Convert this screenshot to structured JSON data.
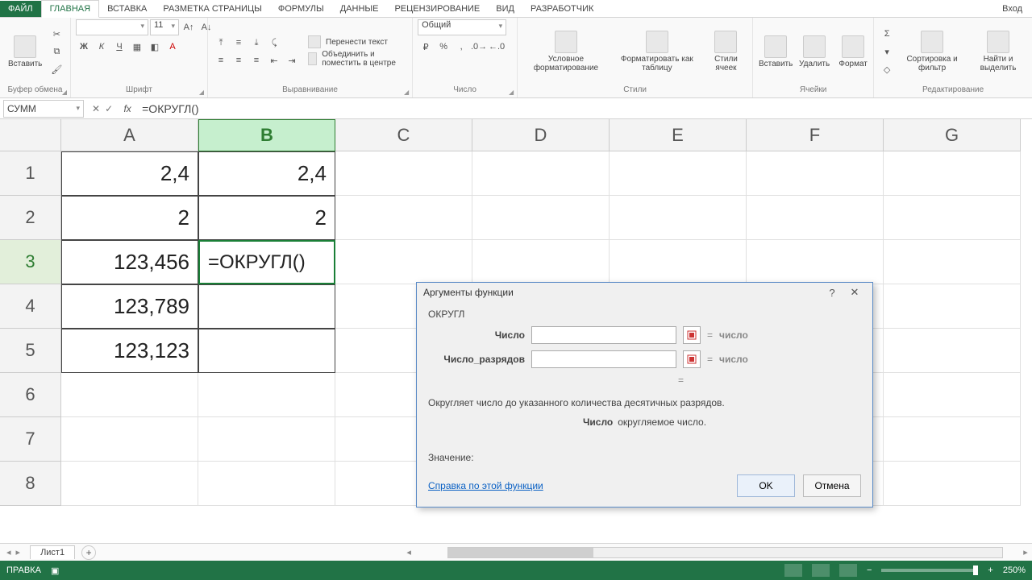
{
  "tabs": {
    "file": "ФАЙЛ",
    "items": [
      "ГЛАВНАЯ",
      "ВСТАВКА",
      "РАЗМЕТКА СТРАНИЦЫ",
      "ФОРМУЛЫ",
      "ДАННЫЕ",
      "РЕЦЕНЗИРОВАНИЕ",
      "ВИД",
      "РАЗРАБОТЧИК"
    ],
    "active_index": 0,
    "signin": "Вход"
  },
  "ribbon": {
    "clipboard": {
      "paste": "Вставить",
      "label": "Буфер обмена"
    },
    "font": {
      "size": "11",
      "bold": "Ж",
      "italic": "К",
      "underline": "Ч",
      "label": "Шрифт"
    },
    "alignment": {
      "wrap": "Перенести текст",
      "merge": "Объединить и поместить в центре",
      "label": "Выравнивание"
    },
    "number": {
      "format": "Общий",
      "percent": "%",
      "comma": "000",
      "label": "Число"
    },
    "styles": {
      "cond": "Условное форматирование",
      "table": "Форматировать как таблицу",
      "cell": "Стили ячеек",
      "label": "Стили"
    },
    "cells": {
      "insert": "Вставить",
      "delete": "Удалить",
      "format": "Формат",
      "label": "Ячейки"
    },
    "editing": {
      "sort": "Сортировка и фильтр",
      "find": "Найти и выделить",
      "label": "Редактирование"
    }
  },
  "formula_bar": {
    "name_box": "СУММ",
    "formula": "=ОКРУГЛ()"
  },
  "columns": [
    "A",
    "B",
    "C",
    "D",
    "E",
    "F",
    "G"
  ],
  "active_col_index": 1,
  "rows": [
    "1",
    "2",
    "3",
    "4",
    "5",
    "6",
    "7",
    "8"
  ],
  "active_row_index": 2,
  "cells": {
    "A1": "2,4",
    "B1": "2,4",
    "A2": "2",
    "B2": "2",
    "A3": "123,456",
    "B3": "=ОКРУГЛ()",
    "A4": "123,789",
    "A5": "123,123"
  },
  "dialog": {
    "title": "Аргументы функции",
    "func": "ОКРУГЛ",
    "arg1_label": "Число",
    "arg2_label": "Число_разрядов",
    "eq": "=",
    "placeholder": "число",
    "description": "Округляет число до указанного количества десятичных разрядов.",
    "arg_desc_name": "Число",
    "arg_desc_text": "округляемое число.",
    "value_label": "Значение:",
    "help_link": "Справка по этой функции",
    "ok": "OK",
    "cancel": "Отмена"
  },
  "sheet_tabs": {
    "active": "Лист1"
  },
  "status": {
    "mode": "ПРАВКА",
    "zoom": "250%"
  }
}
